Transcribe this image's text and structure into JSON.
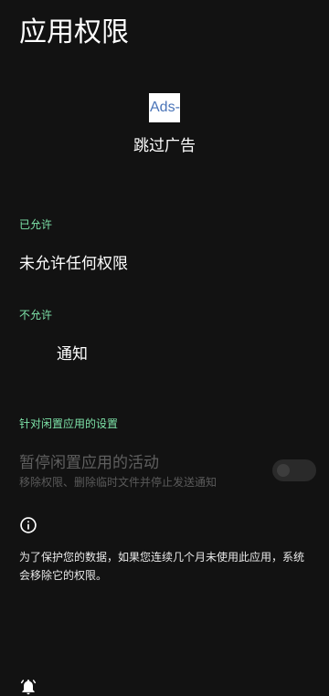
{
  "header": {
    "title": "应用权限"
  },
  "app": {
    "icon_text": "Ads-",
    "name": "跳过广告"
  },
  "allowed": {
    "header": "已允许",
    "empty_label": "未允许任何权限"
  },
  "denied": {
    "header": "不允许",
    "items": [
      {
        "label": "通知",
        "icon": "notifications-off-icon"
      }
    ]
  },
  "unused_settings": {
    "header": "针对闲置应用的设置",
    "pause_title": "暂停闲置应用的活动",
    "pause_summary": "移除权限、删除临时文件并停止发送通知",
    "pause_enabled": false
  },
  "footer": {
    "icon": "info-icon",
    "text": "为了保护您的数据，如果您连续几个月未使用此应用，系统会移除它的权限。"
  },
  "colors": {
    "background": "#121212",
    "accent": "#7ee4a9",
    "disabled_text": "#5f5f5f"
  }
}
